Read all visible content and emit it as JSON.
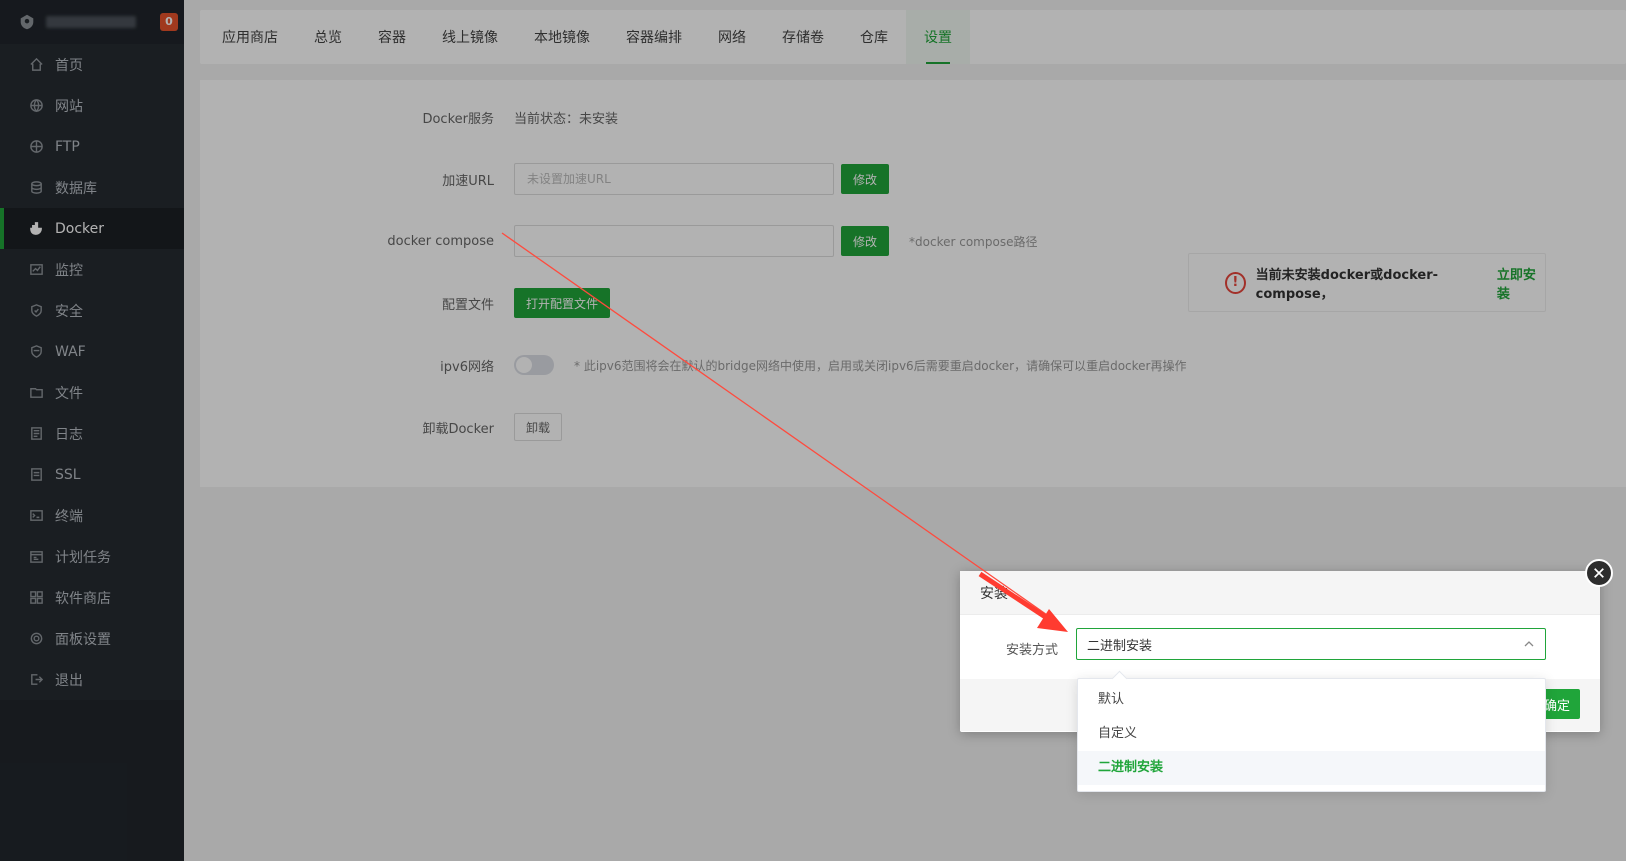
{
  "app": {
    "notify_count": "0"
  },
  "sidebar": {
    "items": [
      {
        "label": "首页",
        "icon": "home-icon"
      },
      {
        "label": "网站",
        "icon": "globe-icon"
      },
      {
        "label": "FTP",
        "icon": "ftp-icon"
      },
      {
        "label": "数据库",
        "icon": "database-icon"
      },
      {
        "label": "Docker",
        "icon": "docker-icon",
        "active": true
      },
      {
        "label": "监控",
        "icon": "monitor-icon"
      },
      {
        "label": "安全",
        "icon": "shield-icon"
      },
      {
        "label": "WAF",
        "icon": "waf-shield-icon"
      },
      {
        "label": "文件",
        "icon": "folder-icon"
      },
      {
        "label": "日志",
        "icon": "log-icon"
      },
      {
        "label": "SSL",
        "icon": "ssl-icon"
      },
      {
        "label": "终端",
        "icon": "terminal-icon"
      },
      {
        "label": "计划任务",
        "icon": "calendar-icon"
      },
      {
        "label": "软件商店",
        "icon": "grid-icon"
      },
      {
        "label": "面板设置",
        "icon": "gear-icon"
      },
      {
        "label": "退出",
        "icon": "logout-icon"
      }
    ]
  },
  "tabs": [
    "应用商店",
    "总览",
    "容器",
    "线上镜像",
    "本地镜像",
    "容器编排",
    "网络",
    "存储卷",
    "仓库",
    "设置"
  ],
  "active_tab": "设置",
  "settings": {
    "docker_service_label": "Docker服务",
    "docker_service_status": "当前状态：未安装",
    "accel_url_label": "加速URL",
    "accel_url_placeholder": "未设置加速URL",
    "accel_url_button": "修改",
    "compose_label": "docker compose",
    "compose_value": "",
    "compose_button": "修改",
    "compose_hint": "*docker compose路径",
    "config_label": "配置文件",
    "config_button": "打开配置文件",
    "ipv6_label": "ipv6网络",
    "ipv6_hint": "* 此ipv6范围将会在默认的bridge网络中使用，启用或关闭ipv6后需要重启docker，请确保可以重启docker再操作",
    "uninstall_label": "卸载Docker",
    "uninstall_button": "卸载"
  },
  "warning": {
    "text": "当前未安装docker或docker-compose，",
    "link": "立即安装"
  },
  "dialog": {
    "title": "安装",
    "field_label": "安装方式",
    "selected_value": "二进制安装",
    "confirm_button": "确定",
    "options": [
      "默认",
      "自定义",
      "二进制安装"
    ],
    "selected_index": 2
  },
  "colors": {
    "accent": "#20a53a",
    "sidebar_bg": "#262b31",
    "warning": "#e8453c",
    "annotation_arrow": "#ff3b30"
  }
}
